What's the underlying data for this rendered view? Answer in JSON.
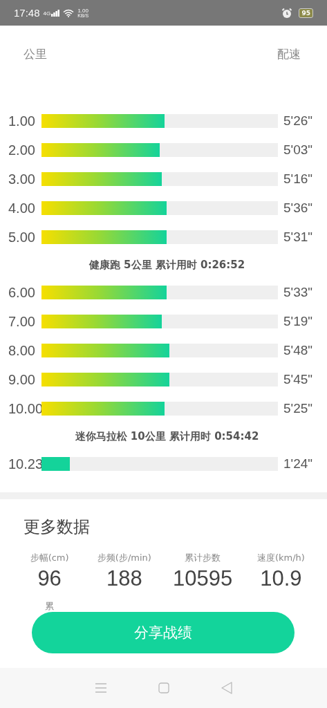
{
  "status_bar": {
    "time": "17:48",
    "network": "4G",
    "speed_value": "1.00",
    "speed_unit": "KB/S",
    "battery": "95"
  },
  "pace_section": {
    "column_left": "公里",
    "column_right": "配速",
    "rows": [
      {
        "kind": "split",
        "km": "1.00",
        "level": 0.52,
        "pace": "5'26\""
      },
      {
        "kind": "split",
        "km": "2.00",
        "level": 0.5,
        "pace": "5'03\""
      },
      {
        "kind": "split",
        "km": "3.00",
        "level": 0.51,
        "pace": "5'16\""
      },
      {
        "kind": "split",
        "km": "4.00",
        "level": 0.53,
        "pace": "5'36\""
      },
      {
        "kind": "split",
        "km": "5.00",
        "level": 0.53,
        "pace": "5'31\""
      },
      {
        "kind": "summary",
        "text": "健康跑 5公里 累计用时 0:26:52"
      },
      {
        "kind": "split",
        "km": "6.00",
        "level": 0.53,
        "pace": "5'33\""
      },
      {
        "kind": "split",
        "km": "7.00",
        "level": 0.51,
        "pace": "5'19\""
      },
      {
        "kind": "split",
        "km": "8.00",
        "level": 0.54,
        "pace": "5'48\""
      },
      {
        "kind": "split",
        "km": "9.00",
        "level": 0.54,
        "pace": "5'45\""
      },
      {
        "kind": "split",
        "km": "10.00",
        "level": 0.52,
        "pace": "5'25\""
      },
      {
        "kind": "summary",
        "text": "迷你马拉松 10公里 累计用时 0:54:42"
      },
      {
        "kind": "partial",
        "km": "10.23",
        "level": 0.12,
        "pace": "1'24\""
      }
    ]
  },
  "more_data": {
    "title": "更多数据",
    "stats": [
      {
        "label": "步幅(cm)",
        "value": "96"
      },
      {
        "label": "步频(步/min)",
        "value": "188"
      },
      {
        "label": "累计步数",
        "value": "10595"
      },
      {
        "label": "速度(km/h)",
        "value": "10.9"
      },
      {
        "label": "累"
      }
    ]
  },
  "share_button": "分享战绩"
}
